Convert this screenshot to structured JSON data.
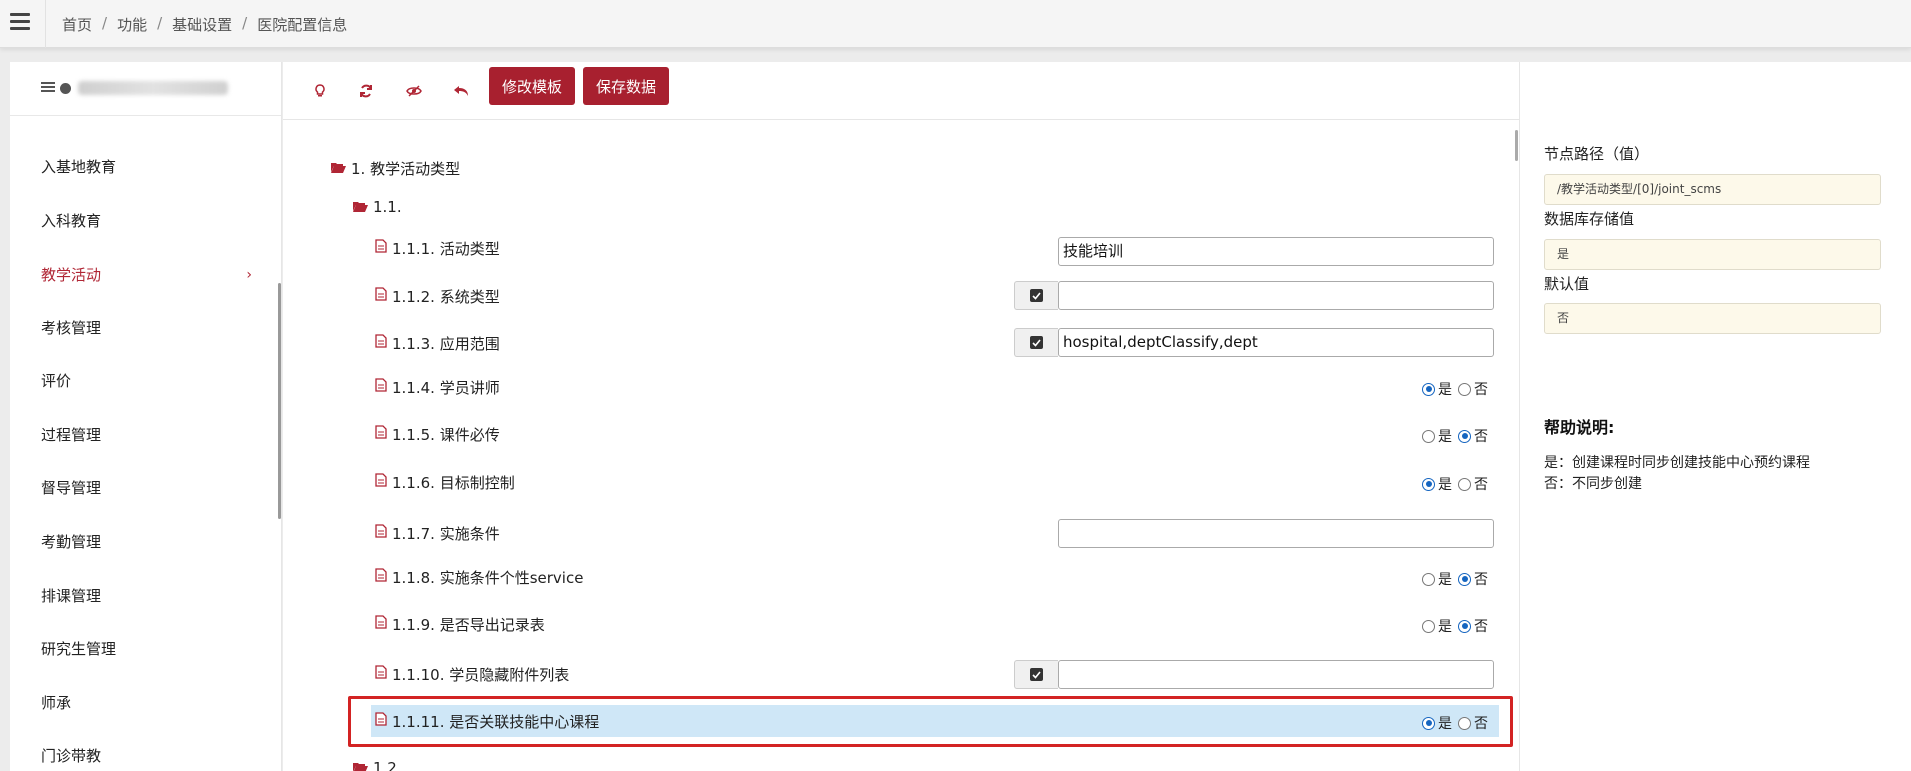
{
  "breadcrumb": [
    "首页",
    "功能",
    "基础设置",
    "医院配置信息"
  ],
  "breadcrumb_sep": "/",
  "sidebar": {
    "items": [
      {
        "label": "入基地教育",
        "active": false
      },
      {
        "label": "入科教育",
        "active": false
      },
      {
        "label": "教学活动",
        "active": true,
        "chevron": "›"
      },
      {
        "label": "考核管理",
        "active": false
      },
      {
        "label": "评价",
        "active": false
      },
      {
        "label": "过程管理",
        "active": false
      },
      {
        "label": "督导管理",
        "active": false
      },
      {
        "label": "考勤管理",
        "active": false
      },
      {
        "label": "排课管理",
        "active": false
      },
      {
        "label": "研究生管理",
        "active": false
      },
      {
        "label": "师承",
        "active": false
      },
      {
        "label": "门诊带教",
        "active": false
      }
    ]
  },
  "toolbar": {
    "icons": [
      "bulb-icon",
      "refresh-icon",
      "eye-slash-icon",
      "undo-icon"
    ],
    "edit_template_label": "修改模板",
    "save_data_label": "保存数据"
  },
  "tree": {
    "root": "1. 教学活动类型",
    "group": "1.1.",
    "next_group": "1.2.",
    "items": [
      {
        "label": "1.1.1. 活动类型",
        "kind": "text",
        "value": "技能培训"
      },
      {
        "label": "1.1.2. 系统类型",
        "kind": "checktext",
        "value": ""
      },
      {
        "label": "1.1.3. 应用范围",
        "kind": "checktext",
        "value": "hospital,deptClassify,dept"
      },
      {
        "label": "1.1.4. 学员讲师",
        "kind": "radio",
        "value": "是"
      },
      {
        "label": "1.1.5. 课件必传",
        "kind": "radio",
        "value": "否"
      },
      {
        "label": "1.1.6. 目标制控制",
        "kind": "radio",
        "value": "是"
      },
      {
        "label": "1.1.7. 实施条件",
        "kind": "text",
        "value": ""
      },
      {
        "label": "1.1.8. 实施条件个性service",
        "kind": "radio",
        "value": "否"
      },
      {
        "label": "1.1.9. 是否导出记录表",
        "kind": "radio",
        "value": "否"
      },
      {
        "label": "1.1.10. 学员隐藏附件列表",
        "kind": "checktext",
        "value": ""
      },
      {
        "label": "1.1.11. 是否关联技能中心课程",
        "kind": "radio",
        "value": "是",
        "selected": true
      }
    ],
    "radio_yes": "是",
    "radio_no": "否"
  },
  "detail": {
    "node_path_label": "节点路径（值）",
    "node_path_value": "/教学活动类型/[0]/joint_scms",
    "db_value_label": "数据库存储值",
    "db_value": "是",
    "default_label": "默认值",
    "default_value": "否",
    "help_title": "帮助说明:",
    "help_lines": [
      "是：创建课程时同步创建技能中心预约课程",
      "否：不同步创建"
    ]
  },
  "colors": {
    "accent": "#a8202f",
    "radio": "#1565c0",
    "highlight": "#cfe7f7",
    "outline": "#d32323"
  }
}
